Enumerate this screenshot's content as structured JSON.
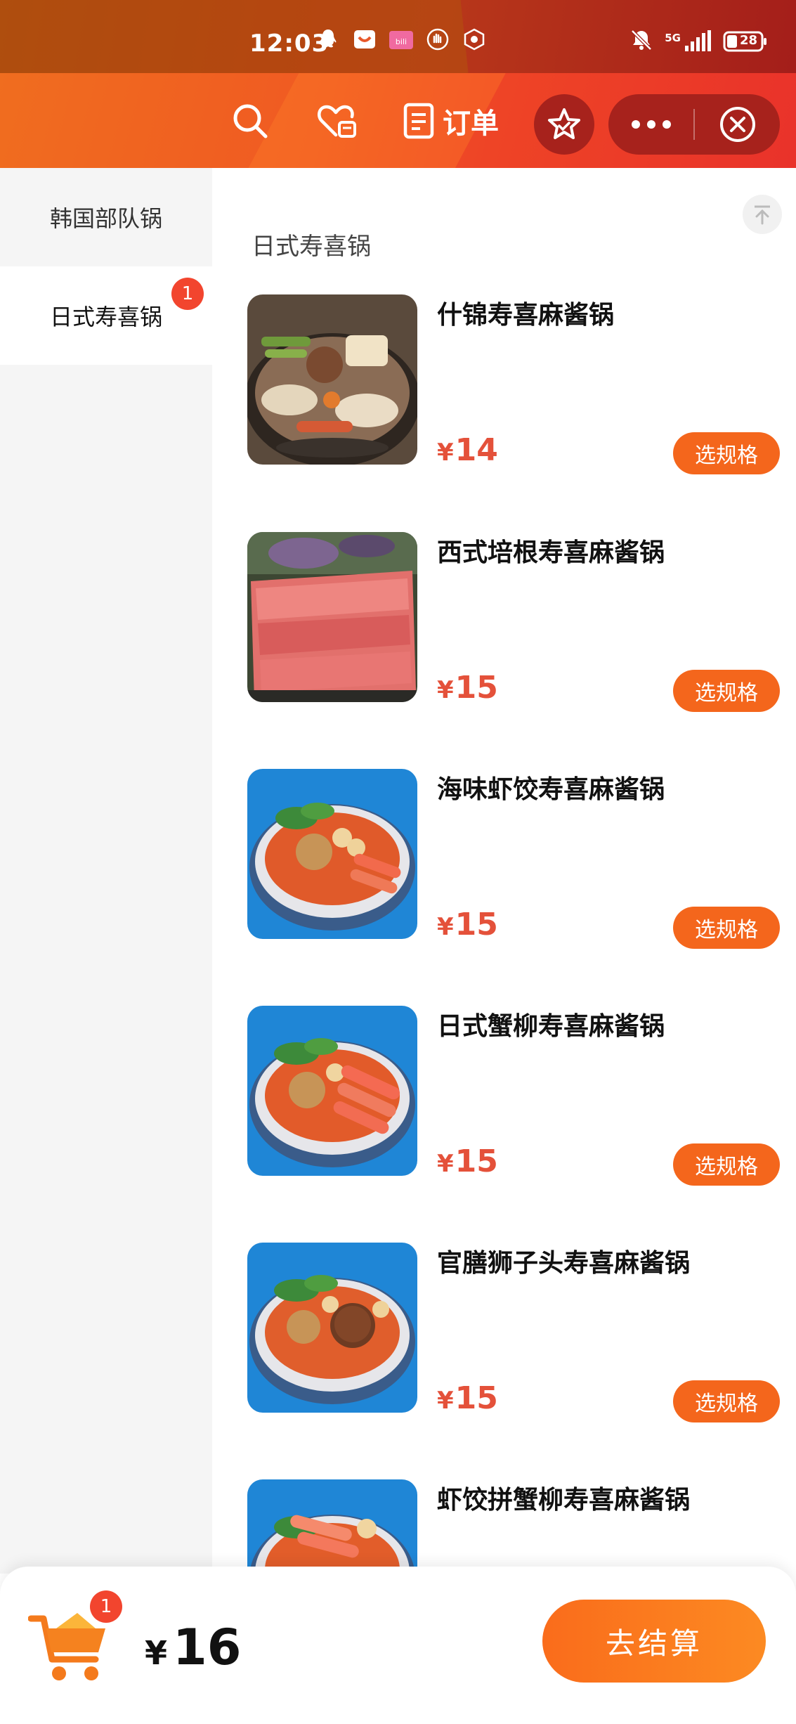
{
  "status_bar": {
    "time": "12:03",
    "network": "5G",
    "battery": "28"
  },
  "toolbar": {
    "orders_label": "订单"
  },
  "sidebar": {
    "items": [
      {
        "label": "韩国部队锅"
      },
      {
        "label": "日式寿喜锅",
        "badge": "1",
        "active": true
      }
    ]
  },
  "content": {
    "category_title": "日式寿喜锅",
    "currency": "¥",
    "spec_label": "选规格",
    "items": [
      {
        "name": "什锦寿喜麻酱锅",
        "price": "14"
      },
      {
        "name": "西式培根寿喜麻酱锅",
        "price": "15"
      },
      {
        "name": "海味虾饺寿喜麻酱锅",
        "price": "15"
      },
      {
        "name": "日式蟹柳寿喜麻酱锅",
        "price": "15"
      },
      {
        "name": "官膳狮子头寿喜麻酱锅",
        "price": "15"
      },
      {
        "name": "虾饺拼蟹柳寿喜麻酱锅",
        "price": ""
      }
    ]
  },
  "cart": {
    "badge": "1",
    "currency": "¥",
    "total": "16",
    "checkout_label": "去结算"
  },
  "colors": {
    "accent": "#f4661c",
    "price": "#e4513a",
    "badge": "#f2452e",
    "header_start": "#f06d1f",
    "header_end": "#e9322a",
    "capsule": "#a7221c"
  }
}
